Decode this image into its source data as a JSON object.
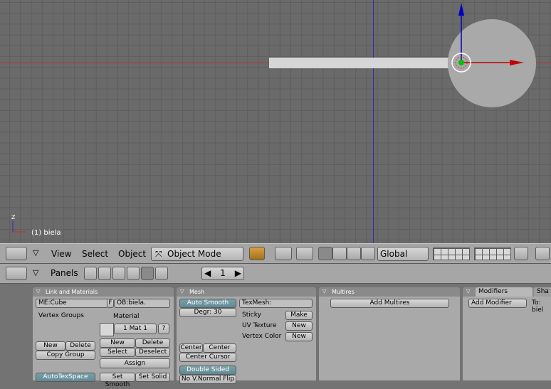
{
  "viewport": {
    "object_label": "(1) biela",
    "axis_z": "Z"
  },
  "header3d": {
    "menu": [
      "View",
      "Select",
      "Object"
    ],
    "mode": "Object Mode",
    "orientation": "Global"
  },
  "buttons_header": {
    "panels_label": "Panels",
    "frame": "1"
  },
  "link_materials": {
    "title": "Link and Materials",
    "me_field": "ME:Cube",
    "f_label": "F",
    "ob_field": "OB:biela.",
    "vertex_groups": "Vertex Groups",
    "material": "Material",
    "mat_slot": "1 Mat 1",
    "question": "?",
    "vg_new": "New",
    "vg_delete": "Delete",
    "copy_group": "Copy Group",
    "m_new": "New",
    "m_delete": "Delete",
    "m_select": "Select",
    "m_deselect": "Deselect",
    "assign": "Assign",
    "autotexspace": "AutoTexSpace",
    "set_smooth": "Set Smooth",
    "set_solid": "Set Solid"
  },
  "mesh": {
    "title": "Mesh",
    "auto_smooth": "Auto Smooth",
    "degr": "Degr: 30",
    "texmesh": "TexMesh:",
    "sticky": "Sticky",
    "make": "Make",
    "uv_texture": "UV Texture",
    "uv_new": "New",
    "vertex_color": "Vertex Color",
    "vc_new": "New",
    "center": "Center",
    "center_new": "Center New",
    "center_cursor": "Center Cursor",
    "double_sided": "Double Sided",
    "no_vnormal_flip": "No V.Normal Flip"
  },
  "multires": {
    "title": "Multires",
    "add": "Add Multires"
  },
  "modifiers": {
    "tab1": "Modifiers",
    "tab2": "Sha",
    "add": "Add Modifier",
    "to": "To: biel"
  }
}
